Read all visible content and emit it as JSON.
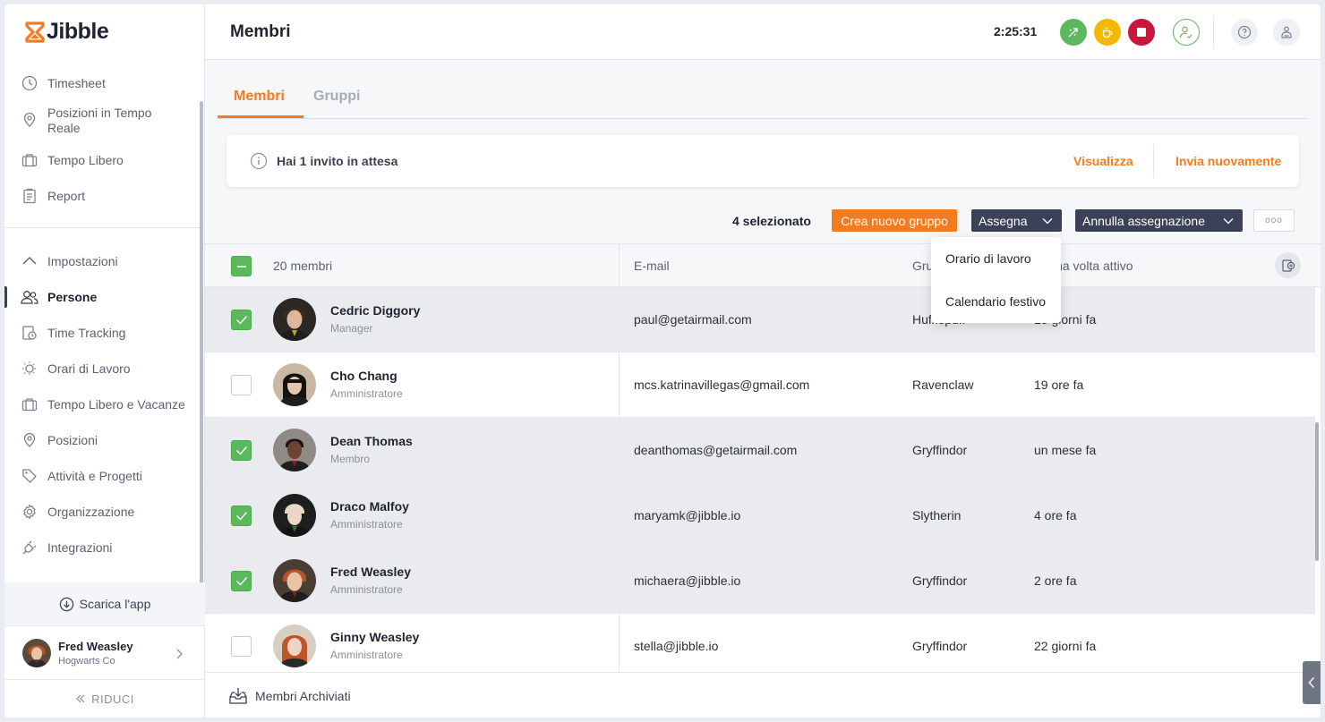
{
  "brand": {
    "name": "Jibble",
    "accent": "#f47b20"
  },
  "sidebar": {
    "top_items": [
      {
        "label": "Timesheet",
        "icon": "clock-icon"
      },
      {
        "label": "Posizioni in Tempo Reale",
        "icon": "location-pin-icon"
      },
      {
        "label": "Tempo Libero",
        "icon": "suitcase-icon"
      },
      {
        "label": "Report",
        "icon": "clipboard-icon"
      }
    ],
    "settings_label": "Impostazioni",
    "settings_items": [
      {
        "label": "Persone",
        "icon": "people-icon",
        "active": true
      },
      {
        "label": "Time Tracking",
        "icon": "time-tracking-icon"
      },
      {
        "label": "Orari di Lavoro",
        "icon": "work-schedule-icon"
      },
      {
        "label": "Tempo Libero e Vacanze",
        "icon": "suitcase-icon"
      },
      {
        "label": "Posizioni",
        "icon": "location-pin-icon"
      },
      {
        "label": "Attività e Progetti",
        "icon": "tag-icon"
      },
      {
        "label": "Organizzazione",
        "icon": "gear-icon"
      },
      {
        "label": "Integrazioni",
        "icon": "plug-icon"
      }
    ],
    "download_app": "Scarica l'app",
    "user": {
      "name": "Fred Weasley",
      "org": "Hogwarts Co"
    },
    "collapse_label": "RIDUCI"
  },
  "header": {
    "title": "Membri",
    "timer": "2:25:31"
  },
  "tabs": [
    {
      "label": "Membri",
      "active": true
    },
    {
      "label": "Gruppi",
      "active": false
    }
  ],
  "invite_banner": {
    "text": "Hai 1 invito in attesa",
    "view_label": "Visualizza",
    "resend_label": "Invia nuovamente"
  },
  "actions": {
    "selected_count": "4 selezionato",
    "create_group": "Crea nuovo gruppo",
    "assign": "Assegna",
    "unassign": "Annulla assegnazione",
    "more": "ooo"
  },
  "assign_menu": [
    "Orario di lavoro",
    "Calendario festivo"
  ],
  "table": {
    "headers": {
      "members": "20 membri",
      "email": "E-mail",
      "group": "Gruppo",
      "last_active": "Ultima volta attivo"
    },
    "rows": [
      {
        "name": "Cedric Diggory",
        "role": "Manager",
        "email": "paul@getairmail.com",
        "group": "Hufflepuff",
        "last_active": "15 giorni fa",
        "selected": true
      },
      {
        "name": "Cho Chang",
        "role": "Amministratore",
        "email": "mcs.katrinavillegas@gmail.com",
        "group": "Ravenclaw",
        "last_active": "19 ore fa",
        "selected": false
      },
      {
        "name": "Dean Thomas",
        "role": "Membro",
        "email": "deanthomas@getairmail.com",
        "group": "Gryffindor",
        "last_active": "un mese fa",
        "selected": true
      },
      {
        "name": "Draco Malfoy",
        "role": "Amministratore",
        "email": "maryamk@jibble.io",
        "group": "Slytherin",
        "last_active": "4 ore fa",
        "selected": true
      },
      {
        "name": "Fred Weasley",
        "role": "Amministratore",
        "email": "michaera@jibble.io",
        "group": "Gryffindor",
        "last_active": "2 ore fa",
        "selected": true
      },
      {
        "name": "Ginny Weasley",
        "role": "Amministratore",
        "email": "stella@jibble.io",
        "group": "Gryffindor",
        "last_active": "22 giorni fa",
        "selected": false
      }
    ]
  },
  "footer": {
    "archived_label": "Membri Archiviati"
  }
}
